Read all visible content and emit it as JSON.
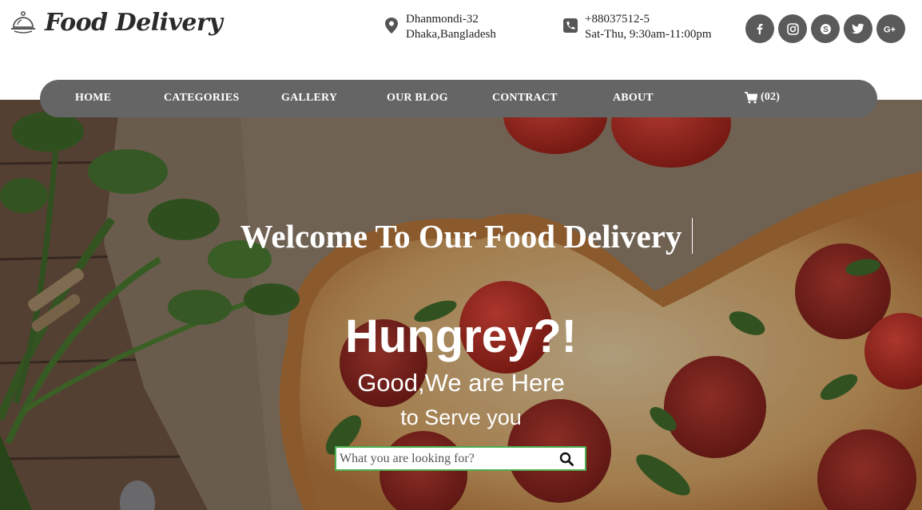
{
  "brand": {
    "name": "Food Delivery",
    "logo_icon": "cloche-icon"
  },
  "contact": {
    "address_line1": "Dhanmondi-32",
    "address_line2": "Dhaka,Bangladesh",
    "phone": "+88037512-5",
    "hours": "Sat-Thu, 9:30am-11:00pm"
  },
  "social": [
    {
      "label": "f",
      "icon": "facebook-icon"
    },
    {
      "label": "◎",
      "icon": "instagram-icon"
    },
    {
      "label": "S",
      "icon": "skype-icon"
    },
    {
      "label": "🐦",
      "icon": "twitter-icon"
    },
    {
      "label": "G+",
      "icon": "google-plus-icon"
    }
  ],
  "nav": {
    "home": "HOME",
    "categories": "CATEGORIES",
    "gallery": "GALLERY",
    "blog": "OUR BLOG",
    "contract": "CONTRACT",
    "about": "ABOUT",
    "cart": "(02)"
  },
  "hero": {
    "welcome": "Welcome To Our Food Delivery",
    "headline": "Hungrey?!",
    "sub1": "Good,We are Here",
    "sub2": "to Serve you"
  },
  "search": {
    "placeholder": "What you are looking for?"
  },
  "colors": {
    "nav_bg": "#656565",
    "social_bg": "#5a5a5a",
    "search_border": "#4caf50"
  }
}
